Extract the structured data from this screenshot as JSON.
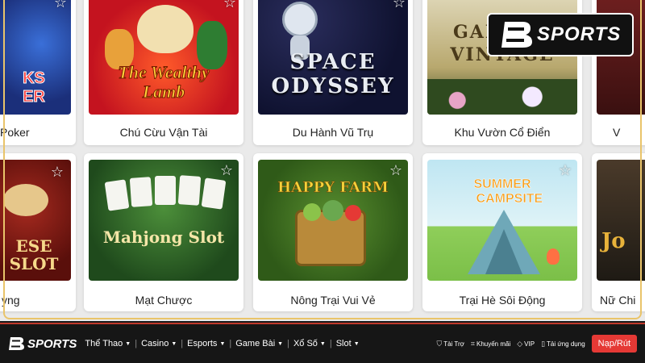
{
  "brand": {
    "name": "SPORTS",
    "accent": "#e53935"
  },
  "games_row1": [
    {
      "title": "Poker",
      "thumb_text": "KS\nER"
    },
    {
      "title": "Chú Cừu Vận Tài",
      "thumb_text": "The Wealthy Lamb"
    },
    {
      "title": "Du Hành Vũ Trụ",
      "thumb_text": "SPACE\nODYSSEY"
    },
    {
      "title": "Khu Vườn Cổ Điển",
      "thumb_text": "GARDEN\nVINTAGE"
    },
    {
      "title": "V"
    }
  ],
  "games_row2": [
    {
      "title": "yng",
      "thumb_text": "ESE\nSLOT"
    },
    {
      "title": "Mạt Chược",
      "thumb_text": "Mahjong Slot"
    },
    {
      "title": "Nông Trại Vui Vẻ",
      "thumb_text": "HAPPY FARM"
    },
    {
      "title": "Trại Hè Sôi Động",
      "thumb_text": "SUMMER\nCAMPSITE"
    },
    {
      "title": "Nữ Chi",
      "thumb_text": "Jo"
    }
  ],
  "nav": {
    "items": [
      "Thể Thao",
      "Casino",
      "Esports",
      "Game Bài",
      "Xổ Số",
      "Slot"
    ],
    "right_links": [
      "Tài Trợ",
      "Khuyến mãi",
      "VIP",
      "Tải ứng dụng"
    ],
    "deposit_label": "Nạp/Rút"
  },
  "icons": {
    "favorite": "star-outline-icon",
    "sponsor": "shield-icon",
    "promo": "tag-icon",
    "vip": "diamond-icon",
    "app": "phone-icon",
    "caret": "chevron-down-icon"
  }
}
